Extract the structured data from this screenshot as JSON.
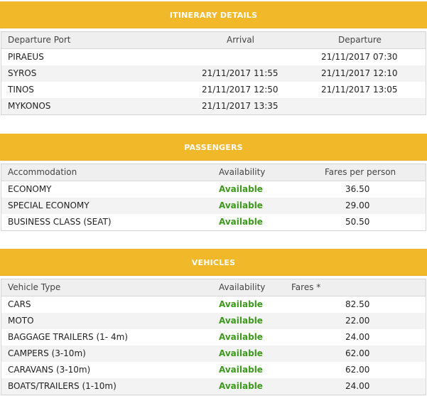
{
  "itinerary": {
    "title": "ITINERARY DETAILS",
    "headers": {
      "port": "Departure Port",
      "arrival": "Arrival",
      "departure": "Departure"
    },
    "rows": [
      {
        "port": "PIRAEUS",
        "arrival": "",
        "departure": "21/11/2017 07:30"
      },
      {
        "port": "SYROS",
        "arrival": "21/11/2017 11:55",
        "departure": "21/11/2017 12:10"
      },
      {
        "port": "TINOS",
        "arrival": "21/11/2017 12:50",
        "departure": "21/11/2017 13:05"
      },
      {
        "port": "MYKONOS",
        "arrival": "21/11/2017 13:35",
        "departure": ""
      }
    ]
  },
  "passengers": {
    "title": "PASSENGERS",
    "headers": {
      "accommodation": "Accommodation",
      "availability": "Availability",
      "fare": "Fares per person"
    },
    "rows": [
      {
        "accommodation": "ECONOMY",
        "availability": "Available",
        "fare": "36.50"
      },
      {
        "accommodation": "SPECIAL ECONOMY",
        "availability": "Available",
        "fare": "29.00"
      },
      {
        "accommodation": "BUSINESS CLASS (SEAT)",
        "availability": "Available",
        "fare": "50.50"
      }
    ]
  },
  "vehicles": {
    "title": "VEHICLES",
    "headers": {
      "type": "Vehicle Type",
      "availability": "Availability",
      "fare": "Fares *"
    },
    "rows": [
      {
        "type": "CARS",
        "availability": "Available",
        "fare": "82.50"
      },
      {
        "type": "MOTO",
        "availability": "Available",
        "fare": "22.00"
      },
      {
        "type": "BAGGAGE TRAILERS (1- 4m)",
        "availability": "Available",
        "fare": "24.00"
      },
      {
        "type": "CAMPERS (3-10m)",
        "availability": "Available",
        "fare": "62.00"
      },
      {
        "type": "CARAVANS (3-10m)",
        "availability": "Available",
        "fare": "62.00"
      },
      {
        "type": "BOATS/TRAILERS (1-10m)",
        "availability": "Available",
        "fare": "24.00"
      }
    ]
  }
}
